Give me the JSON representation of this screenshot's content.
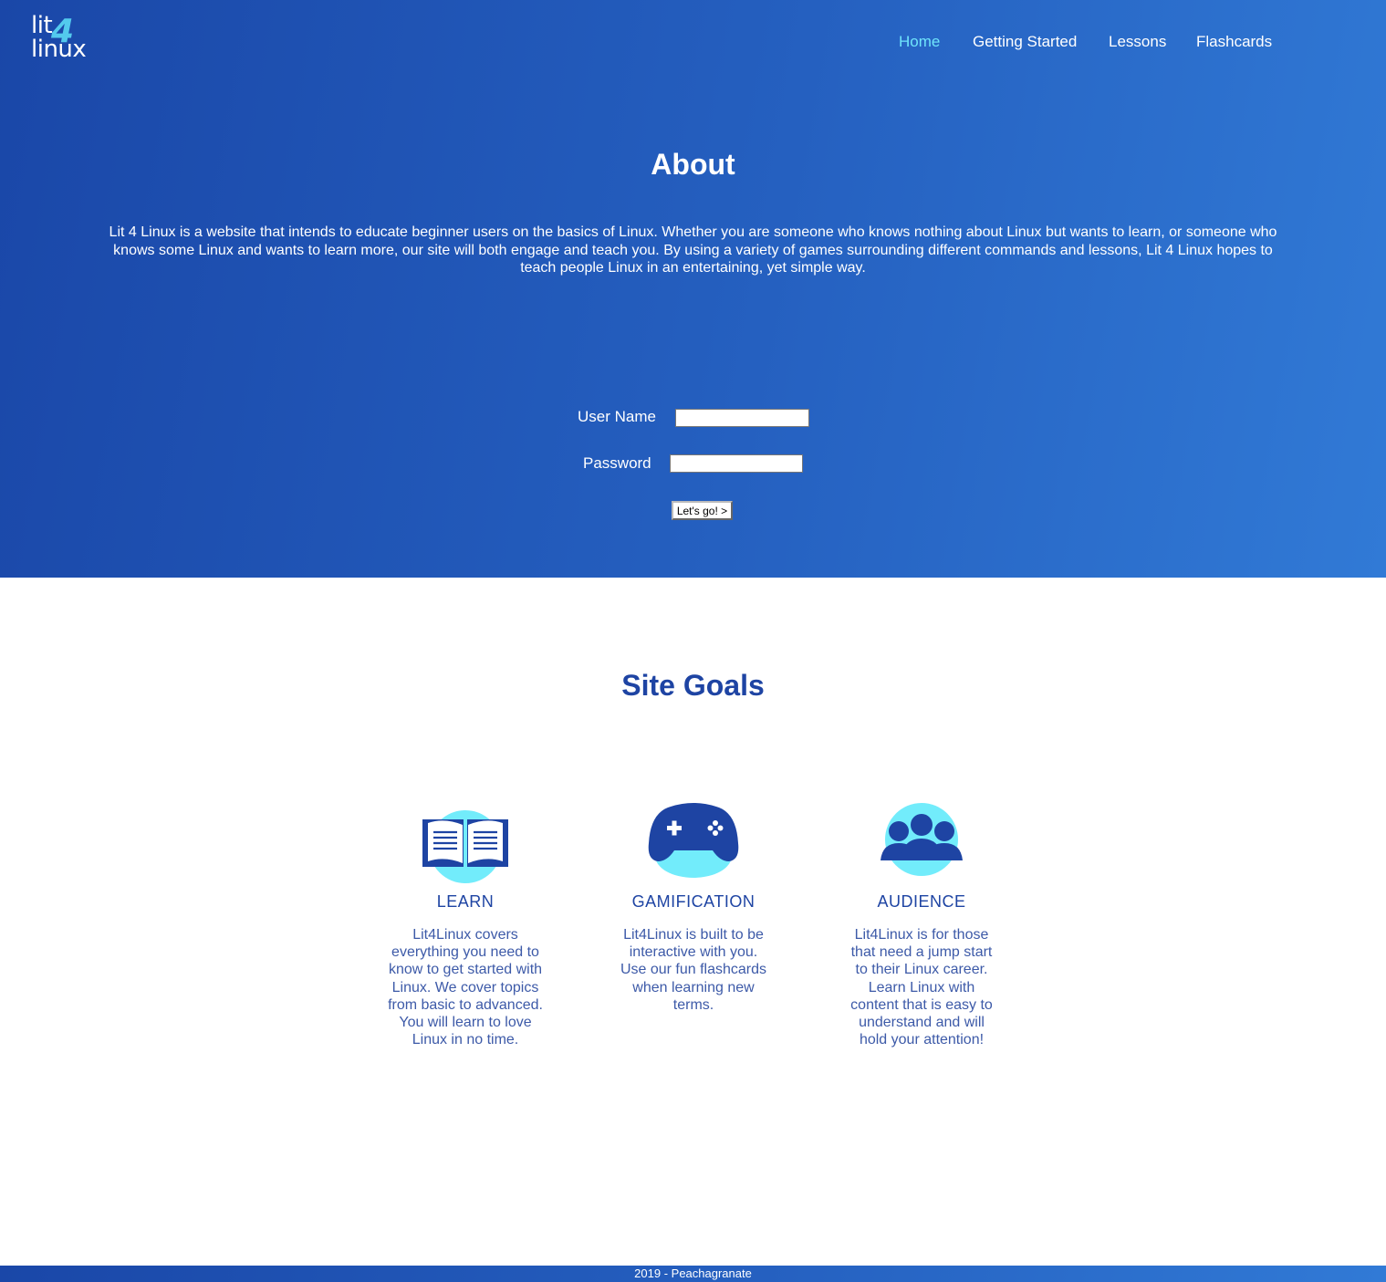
{
  "logo": {
    "line1": "lit",
    "line2": "linux",
    "digit": "4"
  },
  "nav": [
    {
      "label": "Home",
      "active": true
    },
    {
      "label": "Getting Started",
      "active": false
    },
    {
      "label": "Lessons",
      "active": false
    },
    {
      "label": "Flashcards",
      "active": false
    }
  ],
  "about": {
    "title": "About",
    "text": "Lit 4 Linux is a website that intends to educate beginner users on the basics of Linux. Whether you are someone who knows nothing about Linux but wants to learn, or someone who knows some Linux and wants to learn more, our site will both engage and teach you. By using a variety of games surrounding different commands and lessons, Lit 4 Linux hopes to teach people Linux in an entertaining, yet simple way."
  },
  "login": {
    "username_label": "User Name",
    "username_value": "",
    "password_label": "Password",
    "password_value": "",
    "submit_label": "Let's go! >"
  },
  "goals": {
    "title": "Site Goals",
    "items": [
      {
        "icon": "open-book-icon",
        "title": "LEARN",
        "desc": "Lit4Linux covers everything you need to know to get started with Linux. We cover topics from basic to advanced. You will learn to love Linux in no time."
      },
      {
        "icon": "gamepad-icon",
        "title": "GAMIFICATION",
        "desc": "Lit4Linux is built to be interactive with you. Use our fun flashcards when learning new terms."
      },
      {
        "icon": "people-group-icon",
        "title": "AUDIENCE",
        "desc": "Lit4Linux is for those that need a jump start to their Linux career. Learn Linux with content that is easy to understand and will hold your attention!"
      }
    ]
  },
  "footer": {
    "text": "2019 - Peachagranate"
  },
  "colors": {
    "primary": "#1e44a3",
    "accent": "#6fe4fb",
    "gradient_start": "#1a47a8",
    "gradient_end": "#317ad6"
  }
}
